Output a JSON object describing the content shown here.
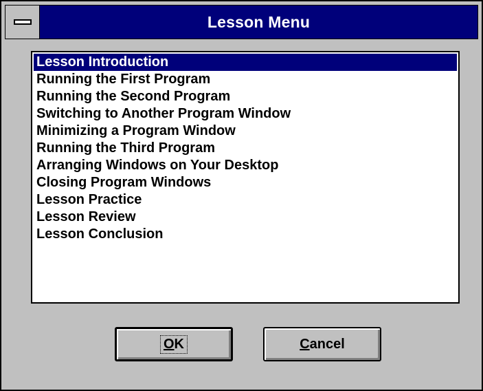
{
  "window": {
    "title": "Lesson Menu",
    "control_menu_icon": "control-menu-dash-icon"
  },
  "lesson_list": {
    "selected_index": 0,
    "items": [
      {
        "label": "Lesson Introduction"
      },
      {
        "label": "Running the First Program"
      },
      {
        "label": "Running the Second Program"
      },
      {
        "label": "Switching to Another Program Window"
      },
      {
        "label": "Minimizing a Program Window"
      },
      {
        "label": "Running the Third Program"
      },
      {
        "label": "Arranging Windows on Your Desktop"
      },
      {
        "label": "Closing Program Windows"
      },
      {
        "label": "Lesson Practice"
      },
      {
        "label": "Lesson Review"
      },
      {
        "label": "Lesson Conclusion"
      }
    ]
  },
  "buttons": {
    "ok": {
      "mnemonic": "O",
      "rest": "K"
    },
    "cancel": {
      "mnemonic": "C",
      "rest": "ancel"
    }
  },
  "colors": {
    "title_bar": "#00007a",
    "selection": "#00007a",
    "face": "#c0c0c0"
  }
}
